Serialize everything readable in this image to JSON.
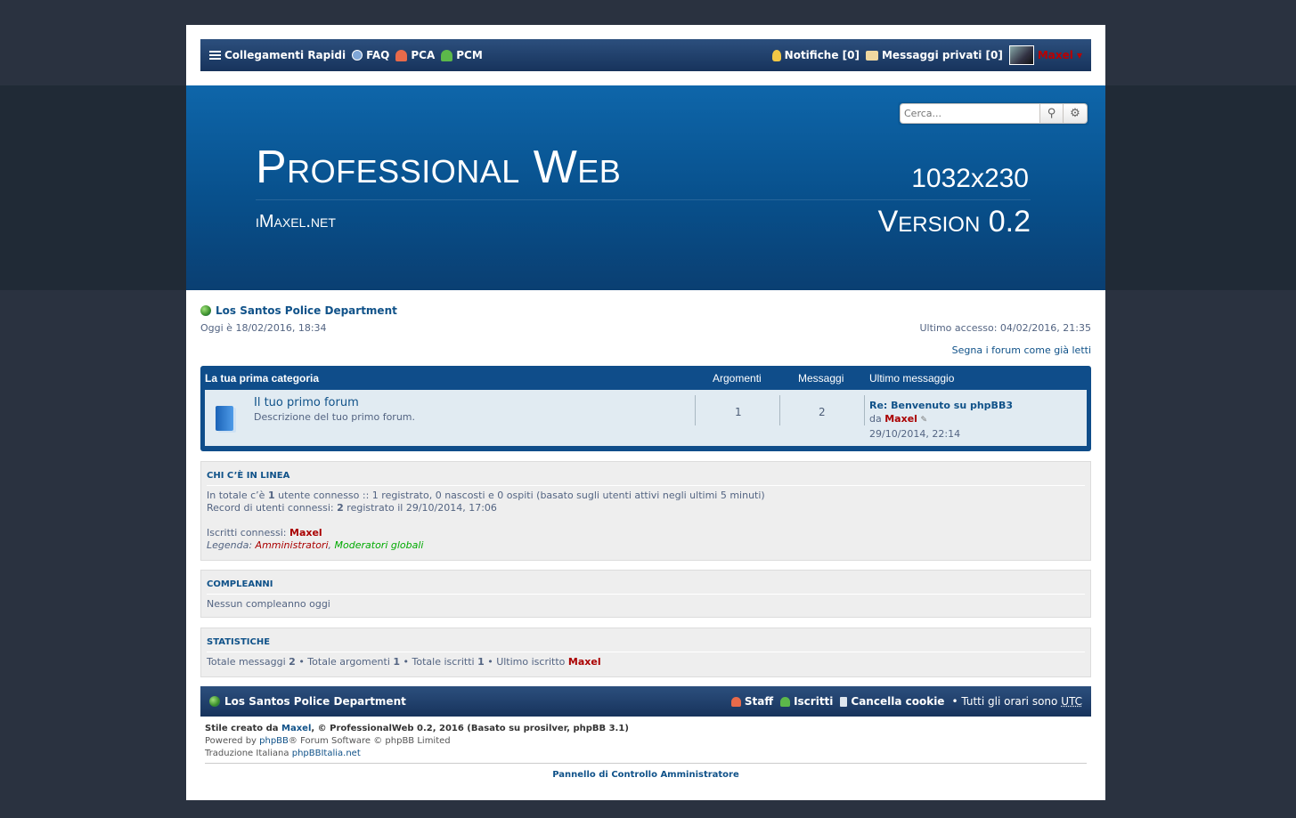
{
  "navbar": {
    "quick_links": "Collegamenti Rapidi",
    "faq": "FAQ",
    "pca": "PCA",
    "pcm": "PCM",
    "notifications": "Notifiche [0]",
    "private_messages": "Messaggi privati [0]",
    "username": "Maxel"
  },
  "header": {
    "search_placeholder": "Cerca...",
    "logo_title": "Professional Web",
    "logo_site": "iMaxel.net",
    "logo_size": "1032x230",
    "logo_version": "Version 0.2"
  },
  "breadcrumb": {
    "site": "Los Santos Police Department",
    "today": "Oggi è 18/02/2016, 18:34",
    "last_visit": "Ultimo accesso: 04/02/2016, 21:35",
    "mark_read": "Segna i forum come già letti"
  },
  "forum_table": {
    "category": "La tua prima categoria",
    "col_topics": "Argomenti",
    "col_posts": "Messaggi",
    "col_last": "Ultimo messaggio",
    "row": {
      "title": "Il tuo primo forum",
      "description": "Descrizione del tuo primo forum.",
      "topics": "1",
      "posts": "2",
      "last_title": "Re: Benvenuto su phpBB3",
      "last_by": "da",
      "last_user": "Maxel",
      "last_date": "29/10/2014, 22:14"
    }
  },
  "online": {
    "heading": "CHI C’È IN LINEA",
    "l1_a": "In totale c’è ",
    "l1_b": "1",
    "l1_c": " utente connesso :: 1 registrato, 0 nascosti e 0 ospiti (basato sugli utenti attivi negli ultimi 5 minuti)",
    "l2_a": "Record di utenti connessi: ",
    "l2_b": "2",
    "l2_c": " registrato il 29/10/2014, 17:06",
    "members_label": "Iscritti connessi: ",
    "members_user": "Maxel",
    "legend_label": "Legenda:",
    "legend_admin": "Amministratori",
    "legend_sep": ",",
    "legend_gmod": "Moderatori globali"
  },
  "birthdays": {
    "heading": "COMPLEANNI",
    "text": "Nessun compleanno oggi"
  },
  "stats": {
    "heading": "STATISTICHE",
    "posts_label": "Totale messaggi ",
    "posts": "2",
    "topics_label": " • Totale argomenti ",
    "topics": "1",
    "members_label": " • Totale iscritti ",
    "members": "1",
    "newest_label": " • Ultimo iscritto ",
    "newest": "Maxel"
  },
  "footer": {
    "site": "Los Santos Police Department",
    "staff": "Staff",
    "members": "Iscritti",
    "delete_cookies": "Cancella cookie",
    "timezone": "• Tutti gli orari sono",
    "tz": "UTC",
    "style_a": "Stile creato da ",
    "style_author": "Maxel",
    "style_b": ", © ProfessionalWeb 0.2, 2016 (Basato su prosilver, phpBB 3.1)",
    "powered_a": "Powered by ",
    "powered_link": "phpBB",
    "powered_b": "® Forum Software © phpBB Limited",
    "translation_a": "Traduzione Italiana ",
    "translation_link": "phpBBItalia.net",
    "acp": "Pannello di Controllo Amministratore"
  }
}
